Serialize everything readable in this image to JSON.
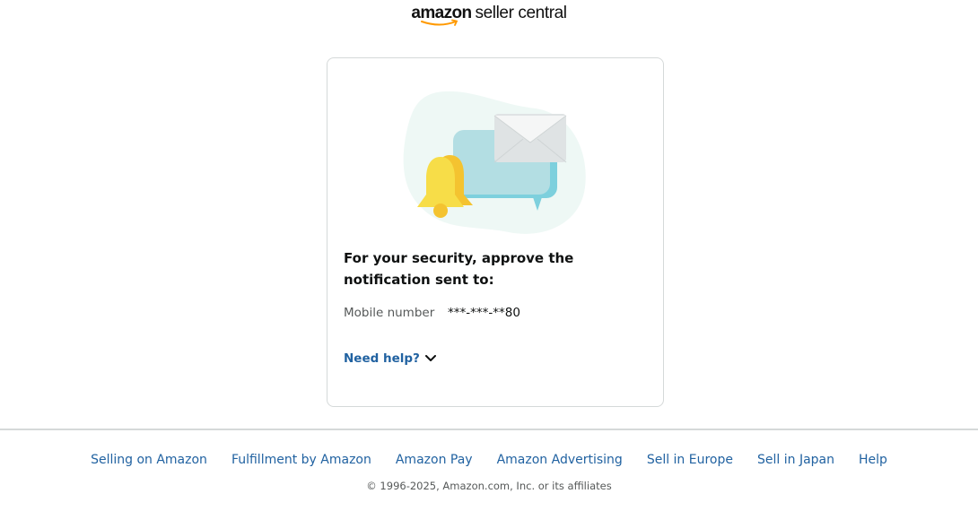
{
  "header": {
    "logo_amazon": "amazon",
    "logo_suffix": "seller central"
  },
  "card": {
    "illustration_icon": "notification-bell-message-icon",
    "title": "For your security, approve the notification sent to:",
    "mobile_label": "Mobile number",
    "mobile_value": "***-***-**80",
    "help_label": "Need help?"
  },
  "footer": {
    "links": [
      "Selling on Amazon",
      "Fulfillment by Amazon",
      "Amazon Pay",
      "Amazon Advertising",
      "Sell in Europe",
      "Sell in Japan",
      "Help"
    ],
    "copyright": "© 1996-2025, Amazon.com, Inc. or its affiliates"
  },
  "colors": {
    "link": "#2162a1",
    "border": "#d5d9d9",
    "bell": "#f7dd48",
    "bubble": "#b3dee3",
    "blob": "#eef8f5"
  }
}
